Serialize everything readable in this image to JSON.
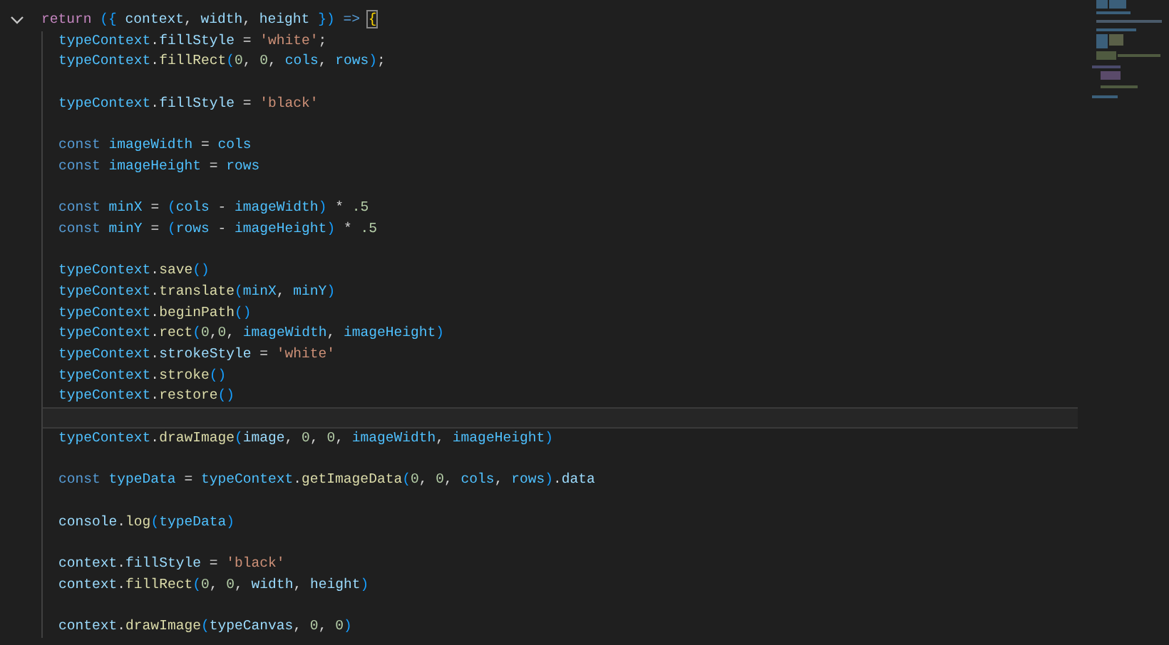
{
  "editor": {
    "lines": [
      {
        "current": false,
        "tokens": [
          {
            "kind": "control",
            "text": "return "
          },
          {
            "kind": "bracket",
            "text": "({"
          },
          {
            "kind": "property",
            "text": " context"
          },
          {
            "kind": "plain",
            "text": ", "
          },
          {
            "kind": "property",
            "text": "width"
          },
          {
            "kind": "plain",
            "text": ", "
          },
          {
            "kind": "property",
            "text": "height "
          },
          {
            "kind": "bracket",
            "text": "})"
          },
          {
            "kind": "storage",
            "text": " => "
          },
          {
            "kind": "bracket-match",
            "text": "{"
          }
        ],
        "children": [
          {
            "current": false,
            "tokens": [
              {
                "kind": "variable",
                "text": "typeContext"
              },
              {
                "kind": "plain",
                "text": "."
              },
              {
                "kind": "property",
                "text": "fillStyle"
              },
              {
                "kind": "plain",
                "text": " = "
              },
              {
                "kind": "string",
                "text": "'white'"
              },
              {
                "kind": "plain",
                "text": ";"
              }
            ]
          },
          {
            "current": false,
            "tokens": [
              {
                "kind": "variable",
                "text": "typeContext"
              },
              {
                "kind": "plain",
                "text": "."
              },
              {
                "kind": "function",
                "text": "fillRect"
              },
              {
                "kind": "bracket",
                "text": "("
              },
              {
                "kind": "number",
                "text": "0"
              },
              {
                "kind": "plain",
                "text": ", "
              },
              {
                "kind": "number",
                "text": "0"
              },
              {
                "kind": "plain",
                "text": ", "
              },
              {
                "kind": "variable",
                "text": "cols"
              },
              {
                "kind": "plain",
                "text": ", "
              },
              {
                "kind": "variable",
                "text": "rows"
              },
              {
                "kind": "bracket",
                "text": ")"
              },
              {
                "kind": "plain",
                "text": ";"
              }
            ]
          },
          {
            "current": false
          },
          {
            "current": false,
            "tokens": [
              {
                "kind": "variable",
                "text": "typeContext"
              },
              {
                "kind": "plain",
                "text": "."
              },
              {
                "kind": "property",
                "text": "fillStyle"
              },
              {
                "kind": "plain",
                "text": " = "
              },
              {
                "kind": "string",
                "text": "'black'"
              }
            ]
          },
          {
            "current": false
          },
          {
            "current": false,
            "tokens": [
              {
                "kind": "storage",
                "text": "const "
              },
              {
                "kind": "variable",
                "text": "imageWidth"
              },
              {
                "kind": "plain",
                "text": " = "
              },
              {
                "kind": "variable",
                "text": "cols"
              }
            ]
          },
          {
            "current": false,
            "tokens": [
              {
                "kind": "storage",
                "text": "const "
              },
              {
                "kind": "variable",
                "text": "imageHeight"
              },
              {
                "kind": "plain",
                "text": " = "
              },
              {
                "kind": "variable",
                "text": "rows"
              }
            ]
          },
          {
            "current": false
          },
          {
            "current": false,
            "tokens": [
              {
                "kind": "storage",
                "text": "const "
              },
              {
                "kind": "variable",
                "text": "minX"
              },
              {
                "kind": "plain",
                "text": " = "
              },
              {
                "kind": "bracket",
                "text": "("
              },
              {
                "kind": "variable",
                "text": "cols"
              },
              {
                "kind": "plain",
                "text": " - "
              },
              {
                "kind": "variable",
                "text": "imageWidth"
              },
              {
                "kind": "bracket",
                "text": ")"
              },
              {
                "kind": "plain",
                "text": " * "
              },
              {
                "kind": "number",
                "text": ".5"
              }
            ]
          },
          {
            "current": false,
            "tokens": [
              {
                "kind": "storage",
                "text": "const "
              },
              {
                "kind": "variable",
                "text": "minY"
              },
              {
                "kind": "plain",
                "text": " = "
              },
              {
                "kind": "bracket",
                "text": "("
              },
              {
                "kind": "variable",
                "text": "rows"
              },
              {
                "kind": "plain",
                "text": " - "
              },
              {
                "kind": "variable",
                "text": "imageHeight"
              },
              {
                "kind": "bracket",
                "text": ")"
              },
              {
                "kind": "plain",
                "text": " * "
              },
              {
                "kind": "number",
                "text": ".5"
              }
            ]
          },
          {
            "current": false
          },
          {
            "current": false,
            "tokens": [
              {
                "kind": "variable",
                "text": "typeContext"
              },
              {
                "kind": "plain",
                "text": "."
              },
              {
                "kind": "function",
                "text": "save"
              },
              {
                "kind": "bracket",
                "text": "()"
              }
            ]
          },
          {
            "current": false,
            "tokens": [
              {
                "kind": "variable",
                "text": "typeContext"
              },
              {
                "kind": "plain",
                "text": "."
              },
              {
                "kind": "function",
                "text": "translate"
              },
              {
                "kind": "bracket",
                "text": "("
              },
              {
                "kind": "variable",
                "text": "minX"
              },
              {
                "kind": "plain",
                "text": ", "
              },
              {
                "kind": "variable",
                "text": "minY"
              },
              {
                "kind": "bracket",
                "text": ")"
              }
            ]
          },
          {
            "current": false,
            "tokens": [
              {
                "kind": "variable",
                "text": "typeContext"
              },
              {
                "kind": "plain",
                "text": "."
              },
              {
                "kind": "function",
                "text": "beginPath"
              },
              {
                "kind": "bracket",
                "text": "()"
              }
            ]
          },
          {
            "current": false,
            "tokens": [
              {
                "kind": "variable",
                "text": "typeContext"
              },
              {
                "kind": "plain",
                "text": "."
              },
              {
                "kind": "function",
                "text": "rect"
              },
              {
                "kind": "bracket",
                "text": "("
              },
              {
                "kind": "number",
                "text": "0"
              },
              {
                "kind": "plain",
                "text": ","
              },
              {
                "kind": "number",
                "text": "0"
              },
              {
                "kind": "plain",
                "text": ", "
              },
              {
                "kind": "variable",
                "text": "imageWidth"
              },
              {
                "kind": "plain",
                "text": ", "
              },
              {
                "kind": "variable",
                "text": "imageHeight"
              },
              {
                "kind": "bracket",
                "text": ")"
              }
            ]
          },
          {
            "current": false,
            "tokens": [
              {
                "kind": "variable",
                "text": "typeContext"
              },
              {
                "kind": "plain",
                "text": "."
              },
              {
                "kind": "property",
                "text": "strokeStyle"
              },
              {
                "kind": "plain",
                "text": " = "
              },
              {
                "kind": "string",
                "text": "'white'"
              }
            ]
          },
          {
            "current": false,
            "tokens": [
              {
                "kind": "variable",
                "text": "typeContext"
              },
              {
                "kind": "plain",
                "text": "."
              },
              {
                "kind": "function",
                "text": "stroke"
              },
              {
                "kind": "bracket",
                "text": "()"
              }
            ]
          },
          {
            "current": false,
            "tokens": [
              {
                "kind": "variable",
                "text": "typeContext"
              },
              {
                "kind": "plain",
                "text": "."
              },
              {
                "kind": "function",
                "text": "restore"
              },
              {
                "kind": "bracket",
                "text": "()"
              }
            ]
          },
          {
            "current": true
          },
          {
            "current": false,
            "tokens": [
              {
                "kind": "variable",
                "text": "typeContext"
              },
              {
                "kind": "plain",
                "text": "."
              },
              {
                "kind": "function",
                "text": "drawImage"
              },
              {
                "kind": "bracket",
                "text": "("
              },
              {
                "kind": "property",
                "text": "image"
              },
              {
                "kind": "plain",
                "text": ", "
              },
              {
                "kind": "number",
                "text": "0"
              },
              {
                "kind": "plain",
                "text": ", "
              },
              {
                "kind": "number",
                "text": "0"
              },
              {
                "kind": "plain",
                "text": ", "
              },
              {
                "kind": "variable",
                "text": "imageWidth"
              },
              {
                "kind": "plain",
                "text": ", "
              },
              {
                "kind": "variable",
                "text": "imageHeight"
              },
              {
                "kind": "bracket",
                "text": ")"
              }
            ]
          },
          {
            "current": false
          },
          {
            "current": false,
            "tokens": [
              {
                "kind": "storage",
                "text": "const "
              },
              {
                "kind": "variable",
                "text": "typeData"
              },
              {
                "kind": "plain",
                "text": " = "
              },
              {
                "kind": "variable",
                "text": "typeContext"
              },
              {
                "kind": "plain",
                "text": "."
              },
              {
                "kind": "function",
                "text": "getImageData"
              },
              {
                "kind": "bracket",
                "text": "("
              },
              {
                "kind": "number",
                "text": "0"
              },
              {
                "kind": "plain",
                "text": ", "
              },
              {
                "kind": "number",
                "text": "0"
              },
              {
                "kind": "plain",
                "text": ", "
              },
              {
                "kind": "variable",
                "text": "cols"
              },
              {
                "kind": "plain",
                "text": ", "
              },
              {
                "kind": "variable",
                "text": "rows"
              },
              {
                "kind": "bracket",
                "text": ")"
              },
              {
                "kind": "plain",
                "text": "."
              },
              {
                "kind": "property",
                "text": "data"
              }
            ]
          },
          {
            "current": false
          },
          {
            "current": false,
            "tokens": [
              {
                "kind": "property",
                "text": "console"
              },
              {
                "kind": "plain",
                "text": "."
              },
              {
                "kind": "function",
                "text": "log"
              },
              {
                "kind": "bracket",
                "text": "("
              },
              {
                "kind": "variable",
                "text": "typeData"
              },
              {
                "kind": "bracket",
                "text": ")"
              }
            ]
          },
          {
            "current": false
          },
          {
            "current": false,
            "tokens": [
              {
                "kind": "property",
                "text": "context"
              },
              {
                "kind": "plain",
                "text": "."
              },
              {
                "kind": "property",
                "text": "fillStyle"
              },
              {
                "kind": "plain",
                "text": " = "
              },
              {
                "kind": "string",
                "text": "'black'"
              }
            ]
          },
          {
            "current": false,
            "tokens": [
              {
                "kind": "property",
                "text": "context"
              },
              {
                "kind": "plain",
                "text": "."
              },
              {
                "kind": "function",
                "text": "fillRect"
              },
              {
                "kind": "bracket",
                "text": "("
              },
              {
                "kind": "number",
                "text": "0"
              },
              {
                "kind": "plain",
                "text": ", "
              },
              {
                "kind": "number",
                "text": "0"
              },
              {
                "kind": "plain",
                "text": ", "
              },
              {
                "kind": "property",
                "text": "width"
              },
              {
                "kind": "plain",
                "text": ", "
              },
              {
                "kind": "property",
                "text": "height"
              },
              {
                "kind": "bracket",
                "text": ")"
              }
            ]
          },
          {
            "current": false
          },
          {
            "current": false,
            "tokens": [
              {
                "kind": "property",
                "text": "context"
              },
              {
                "kind": "plain",
                "text": "."
              },
              {
                "kind": "function",
                "text": "drawImage"
              },
              {
                "kind": "bracket",
                "text": "("
              },
              {
                "kind": "property",
                "text": "typeCanvas"
              },
              {
                "kind": "plain",
                "text": ", "
              },
              {
                "kind": "number",
                "text": "0"
              },
              {
                "kind": "plain",
                "text": ", "
              },
              {
                "kind": "number",
                "text": "0"
              },
              {
                "kind": "bracket",
                "text": ")"
              }
            ]
          }
        ]
      }
    ]
  }
}
